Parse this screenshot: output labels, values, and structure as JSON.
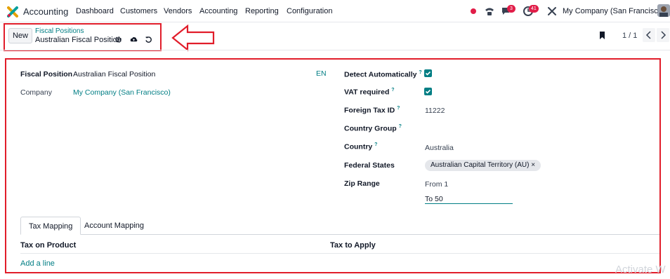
{
  "navbar": {
    "app_name": "Accounting",
    "menu": [
      "Dashboard",
      "Customers",
      "Vendors",
      "Accounting",
      "Reporting",
      "Configuration"
    ],
    "messages_badge": "3",
    "activities_badge": "41",
    "company": "My Company (San Francisco)"
  },
  "control_panel": {
    "new_label": "New",
    "breadcrumb_parent": "Fiscal Positions",
    "breadcrumb_current": "Australian Fiscal Position",
    "pager": "1 / 1"
  },
  "form": {
    "fiscal_position_label": "Fiscal Position",
    "fiscal_position_value": "Australian Fiscal Position",
    "lang_badge": "EN",
    "company_label": "Company",
    "company_value": "My Company (San Francisco)",
    "detect_auto_label": "Detect Automatically",
    "detect_auto_checked": true,
    "vat_required_label": "VAT required",
    "vat_required_checked": true,
    "foreign_tax_id_label": "Foreign Tax ID",
    "foreign_tax_id_value": "11222",
    "country_group_label": "Country Group",
    "country_group_value": "",
    "country_label": "Country",
    "country_value": "Australia",
    "federal_states_label": "Federal States",
    "federal_state_tag": "Australian Capital Territory (AU)",
    "zip_range_label": "Zip Range",
    "zip_from": "From 1",
    "zip_to": "To 50",
    "help_mark": "?"
  },
  "tabs": {
    "items": [
      "Tax Mapping",
      "Account Mapping"
    ],
    "active": "Tax Mapping"
  },
  "table": {
    "columns": [
      "Tax on Product",
      "Tax to Apply"
    ],
    "add_line": "Add a line"
  },
  "watermark": "Activate W",
  "colors": {
    "accent": "#017e84",
    "annotation_red": "#e11d2a",
    "badge": "#e11d48"
  }
}
